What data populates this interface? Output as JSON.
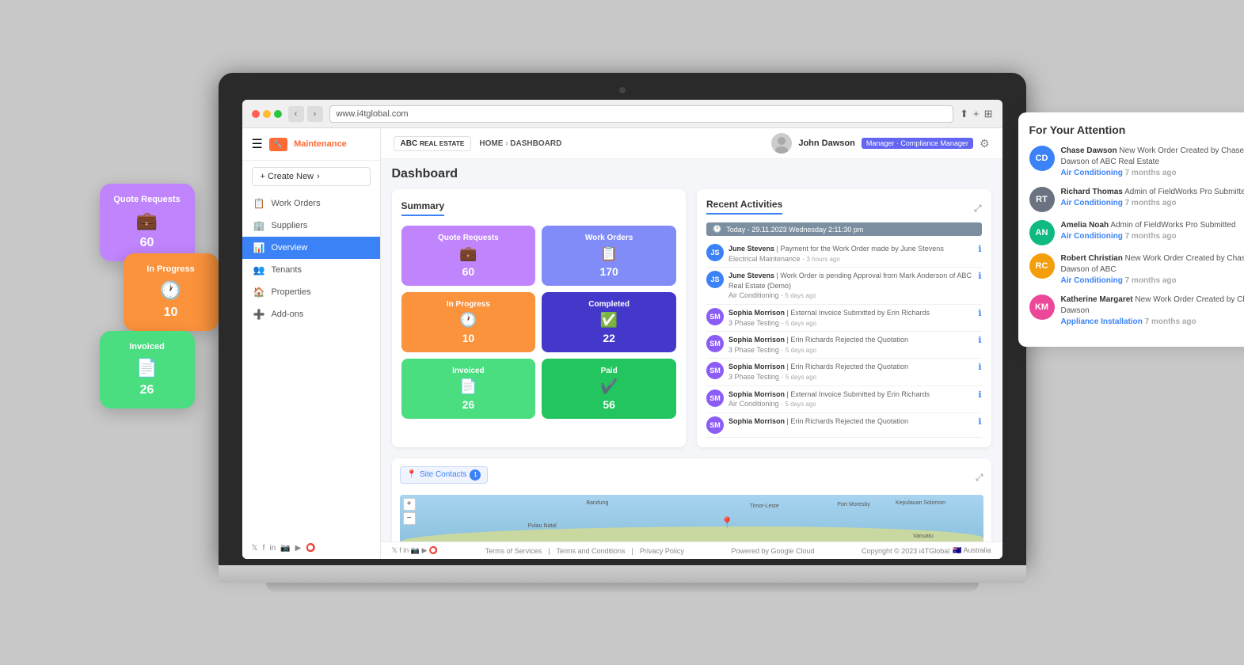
{
  "browser": {
    "url": "www.i4tglobal.com",
    "back": "‹",
    "forward": "›"
  },
  "topbar": {
    "company": "ABC",
    "user_name": "John Dawson",
    "user_role": "Manager · Compliance Manager",
    "breadcrumb_home": "HOME",
    "breadcrumb_current": "DASHBOARD"
  },
  "page": {
    "title": "Dashboard"
  },
  "sidebar": {
    "app_name": "Maintenance",
    "create_btn": "+ Create New",
    "nav_items": [
      {
        "label": "Work Orders",
        "icon": "📋"
      },
      {
        "label": "Suppliers",
        "icon": "🏢"
      },
      {
        "label": "Overview",
        "icon": "📊",
        "active": true
      },
      {
        "label": "Tenants",
        "icon": "👥"
      },
      {
        "label": "Properties",
        "icon": "🏠"
      },
      {
        "label": "Add-ons",
        "icon": "➕"
      }
    ]
  },
  "summary": {
    "title": "Summary",
    "tiles": [
      {
        "label": "Quote Requests",
        "icon": "💼",
        "count": "60",
        "color": "tile-purple"
      },
      {
        "label": "Work Orders",
        "icon": "📋",
        "count": "170",
        "color": "tile-indigo"
      },
      {
        "label": "In Progress",
        "icon": "🕐",
        "count": "10",
        "color": "tile-orange"
      },
      {
        "label": "Completed",
        "icon": "✅",
        "count": "22",
        "color": "tile-dark"
      },
      {
        "label": "Invoiced",
        "icon": "📄",
        "count": "26",
        "color": "tile-green"
      },
      {
        "label": "Paid",
        "icon": "✔️",
        "count": "56",
        "color": "tile-green2"
      }
    ]
  },
  "activities": {
    "title": "Recent Activities",
    "date_bar": "Today - 29.11.2023 Wednesday 2:11:30 pm",
    "items": [
      {
        "name": "June Stevens",
        "action": "Payment for the Work Order made by June Stevens",
        "category": "Electrical Maintenance",
        "time": "3 hours ago",
        "initials": "JS",
        "color": "av-blue"
      },
      {
        "name": "June Stevens",
        "action": "Work Order is pending Approval from Mark Anderson of ABC Real Estate (Demo)",
        "category": "Air Conditioning",
        "time": "5 days ago",
        "initials": "JS",
        "color": "av-blue"
      },
      {
        "name": "Sophia Morrison",
        "action": "External Invoice Submitted by Erin Richards",
        "category": "3 Phase Testing",
        "time": "5 days ago",
        "initials": "SM",
        "color": "av-purple"
      },
      {
        "name": "Sophia Morrison",
        "action": "Erin Richards Rejected the Quotation",
        "category": "3 Phase Testing",
        "time": "5 days ago",
        "initials": "SM",
        "color": "av-purple"
      },
      {
        "name": "Sophia Morrison",
        "action": "Erin Richards Rejected the Quotation",
        "category": "3 Phase Testing",
        "time": "5 days ago",
        "initials": "SM",
        "color": "av-purple"
      },
      {
        "name": "Sophia Morrison",
        "action": "External Invoice Submitted by Erin Richards",
        "category": "Air Conditioning",
        "time": "5 days ago",
        "initials": "SM",
        "color": "av-purple"
      },
      {
        "name": "Sophia Morrison",
        "action": "Erin Richards Rejected the Quotation",
        "category": "",
        "time": "5 days ago",
        "initials": "SM",
        "color": "av-purple"
      }
    ]
  },
  "site_contacts": {
    "tab_label": "Site Contacts",
    "badge": "1"
  },
  "attention": {
    "title": "For Your Attention",
    "items": [
      {
        "name": "Chase Dawson",
        "action": "New Work Order Created by Chase Dawson of ABC Real Estate",
        "category": "Air Conditioning",
        "time": "7 months ago",
        "initials": "CD",
        "color": "av-blue"
      },
      {
        "name": "Richard Thomas",
        "action": "Admin of FieldWorks Pro Submitted",
        "category": "Air Conditioning",
        "time": "7 months ago",
        "initials": "RT",
        "color": "av-gray"
      },
      {
        "name": "Amelia Noah",
        "action": "Admin of FieldWorks Pro Submitted",
        "category": "Air Conditioning",
        "time": "7 months ago",
        "initials": "AN",
        "color": "av-green"
      },
      {
        "name": "Robert Christian",
        "action": "New Work Order Created by Chase Dawson of ABC",
        "category": "Air Conditioning",
        "time": "7 months ago",
        "initials": "RC",
        "color": "av-orange"
      },
      {
        "name": "Katherine Margaret",
        "action": "New Work Order Created by Chase Dawson",
        "category": "Appliance Installation",
        "time": "7 months ago",
        "initials": "KM",
        "color": "av-pink"
      }
    ]
  },
  "floating_cards": [
    {
      "label": "Quote Requests",
      "icon": "💼",
      "count": "60",
      "class": "purple"
    },
    {
      "label": "In Progress",
      "icon": "🕐",
      "count": "10",
      "class": "orange"
    },
    {
      "label": "Invoiced",
      "icon": "📄",
      "count": "26",
      "class": "green"
    }
  ],
  "footer": {
    "social_icons": [
      "𝕏",
      "f",
      "in",
      "📷",
      "▶",
      "⭕"
    ],
    "links": [
      "Terms of Services",
      "Terms and Conditions",
      "Privacy Policy"
    ],
    "powered_by": "Powered by Google Cloud",
    "copyright": "Copyright © 2023 i4TGlobal",
    "country": "🇦🇺 Australia"
  },
  "map": {
    "labels": [
      "Bandung",
      "Timor-Leste",
      "Port Moresby",
      "Kepulauan Solomon",
      "Pulau Natal",
      "Vanuatu"
    ],
    "zoom_in": "+",
    "zoom_out": "−"
  }
}
